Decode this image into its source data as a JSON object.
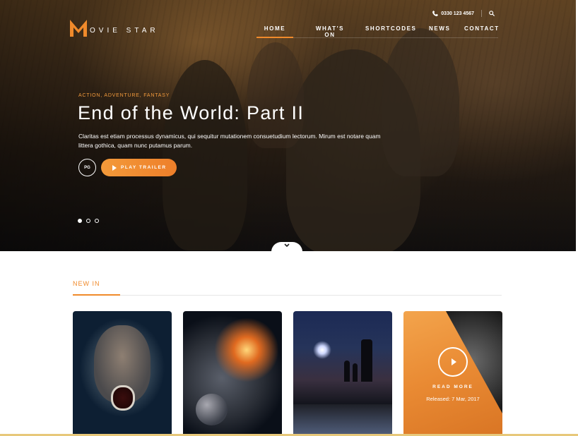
{
  "brand": {
    "name": "MOVIE STAR",
    "mark_letter": "M",
    "accent_color": "#f08a2b"
  },
  "topbar": {
    "phone": "0330 123 4567",
    "phone_icon": "phone-icon",
    "search_icon": "search-icon"
  },
  "nav": {
    "items": [
      {
        "label": "HOME",
        "active": true
      },
      {
        "label": "WHAT'S ON",
        "active": false
      },
      {
        "label": "SHORTCODES",
        "active": false
      },
      {
        "label": "NEWS",
        "active": false
      },
      {
        "label": "CONTACT",
        "active": false
      }
    ]
  },
  "hero": {
    "genres": "ACTION, ADVENTURE, FANTASY",
    "title": "End of the World: Part II",
    "synopsis": "Claritas est etiam processus dynamicus, qui sequitur mutationem consuetudium lectorum. Mirum est notare quam littera gothica, quam nunc putamus parum.",
    "rating": "PG",
    "trailer_button": "PLAY TRAILER",
    "slides_total": 3,
    "slide_active": 1
  },
  "new_in": {
    "heading": "NEW IN",
    "cards": [
      {
        "image": "screaming-child-poster"
      },
      {
        "image": "planet-impact-poster"
      },
      {
        "image": "city-alley-poster"
      },
      {
        "image": "featured-overlay",
        "cta": "READ MORE",
        "released": "Released: 7 Mar, 2017"
      }
    ]
  }
}
